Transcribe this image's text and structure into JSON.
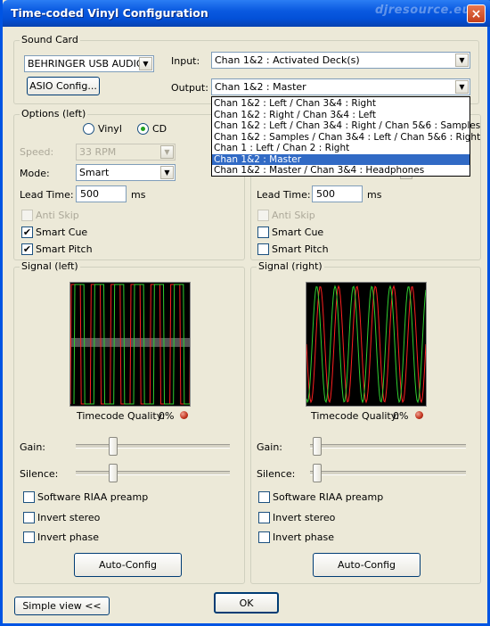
{
  "window": {
    "title": "Time-coded Vinyl Configuration",
    "watermark": "djresource.eu",
    "close_glyph": "×"
  },
  "sound_card": {
    "group_title": "Sound Card",
    "device": "BEHRINGER USB AUDIO",
    "asio_button": "ASIO Config...",
    "input_label": "Input:",
    "input_value": "Chan 1&2 : Activated Deck(s)",
    "output_label": "Output:",
    "output_value": "Chan 1&2 : Master",
    "output_options": [
      "Chan 1&2 : Left / Chan 3&4 : Right",
      "Chan 1&2 : Right / Chan 3&4 : Left",
      "Chan 1&2 : Left / Chan 3&4 : Right / Chan 5&6 : Samples",
      "Chan 1&2 : Samples / Chan 3&4 : Left / Chan 5&6 : Right",
      "Chan 1 : Left / Chan 2 : Right",
      "Chan 1&2 : Master",
      "Chan 1&2 : Master / Chan 3&4 : Headphones"
    ],
    "selected_option_index": 5
  },
  "options_left": {
    "group_title": "Options (left)",
    "vinyl_label": "Vinyl",
    "cd_label": "CD",
    "selected_source": "CD",
    "speed_label": "Speed:",
    "speed_value": "33 RPM",
    "mode_label": "Mode:",
    "mode_value": "Smart",
    "lead_time_label": "Lead Time:",
    "lead_time_value": "500",
    "lead_time_unit": "ms",
    "anti_skip_label": "Anti Skip",
    "anti_skip_checked": false,
    "smart_cue_label": "Smart Cue",
    "smart_cue_checked": true,
    "smart_pitch_label": "Smart Pitch",
    "smart_pitch_checked": true
  },
  "options_right": {
    "lead_time_label": "Lead Time:",
    "lead_time_value": "500",
    "lead_time_unit": "ms",
    "anti_skip_label": "Anti Skip",
    "anti_skip_checked": false,
    "smart_cue_label": "Smart Cue",
    "smart_cue_checked": false,
    "smart_pitch_label": "Smart Pitch",
    "smart_pitch_checked": false
  },
  "signal_left": {
    "group_title": "Signal (left)",
    "quality_label": "Timecode Quality:",
    "quality_value": "0%",
    "gain_label": "Gain:",
    "gain_level": 0.23,
    "silence_label": "Silence:",
    "silence_level": 0.23,
    "riaa_label": "Software RIAA preamp",
    "riaa_checked": false,
    "invert_stereo_label": "Invert stereo",
    "invert_stereo_checked": false,
    "invert_phase_label": "Invert phase",
    "invert_phase_checked": false,
    "auto_config_button": "Auto-Config"
  },
  "signal_right": {
    "group_title": "Signal (right)",
    "quality_label": "Timecode Quality:",
    "quality_value": "0%",
    "gain_label": "Gain:",
    "gain_level": 0.02,
    "silence_label": "Silence:",
    "silence_level": 0.02,
    "riaa_label": "Software RIAA preamp",
    "riaa_checked": false,
    "invert_stereo_label": "Invert stereo",
    "invert_stereo_checked": false,
    "invert_phase_label": "Invert phase",
    "invert_phase_checked": false,
    "auto_config_button": "Auto-Config"
  },
  "footer": {
    "simple_view_button": "Simple view <<",
    "ok_button": "OK"
  },
  "colors": {
    "scope_red": "#ff2020",
    "scope_green": "#30d030",
    "selection": "#316ac5",
    "titlebar": "#0a5ae0"
  }
}
